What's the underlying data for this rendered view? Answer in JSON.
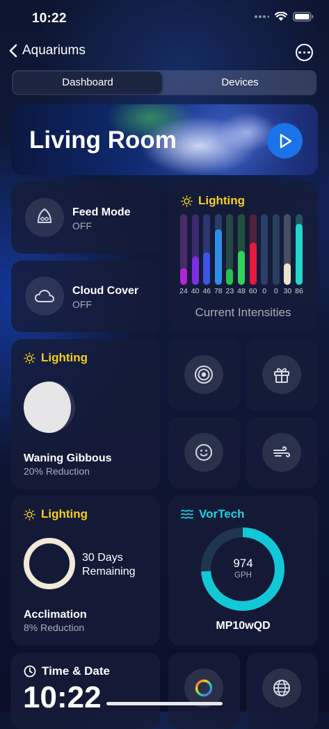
{
  "status": {
    "time": "10:22"
  },
  "nav": {
    "back_label": "Aquariums"
  },
  "segments": {
    "dashboard": "Dashboard",
    "devices": "Devices"
  },
  "hero": {
    "title": "Living Room"
  },
  "feed": {
    "title": "Feed Mode",
    "status": "OFF"
  },
  "cloud": {
    "title": "Cloud Cover",
    "status": "OFF"
  },
  "lighting_bars": {
    "title": "Lighting",
    "caption": "Current Intensities",
    "channels": [
      {
        "value": 24,
        "label": "24",
        "color": "#b026d6",
        "track": "#4a2a6a"
      },
      {
        "value": 40,
        "label": "40",
        "color": "#7b2fe0",
        "track": "#3a2c6e"
      },
      {
        "value": 46,
        "label": "46",
        "color": "#3f55e6",
        "track": "#2c3670"
      },
      {
        "value": 78,
        "label": "78",
        "color": "#2f8ee8",
        "track": "#263e6a"
      },
      {
        "value": 23,
        "label": "23",
        "color": "#26c24a",
        "track": "#234a44"
      },
      {
        "value": 48,
        "label": "48",
        "color": "#2fd45a",
        "track": "#22523e"
      },
      {
        "value": 60,
        "label": "60",
        "color": "#e8193c",
        "track": "#52223a"
      },
      {
        "value": 0,
        "label": "0",
        "color": "#3d6bb0",
        "track": "#2c3f66"
      },
      {
        "value": 0,
        "label": "0",
        "color": "#2e5a90",
        "track": "#28405e"
      },
      {
        "value": 30,
        "label": "30",
        "color": "#ebe6c8",
        "track": "#464d64"
      },
      {
        "value": 86,
        "label": "86",
        "color": "#27d4c8",
        "track": "#24525e"
      }
    ]
  },
  "moon": {
    "heading": "Lighting",
    "title": "Waning Gibbous",
    "subtitle": "20% Reduction"
  },
  "acclimation": {
    "heading": "Lighting",
    "days_line1": "30 Days",
    "days_line2": "Remaining",
    "title": "Acclimation",
    "subtitle": "8% Reduction"
  },
  "vortech": {
    "heading": "VorTech",
    "value": "974",
    "unit": "GPH",
    "model": "MP10wQD",
    "fill_fraction": 0.74
  },
  "timedate": {
    "heading": "Time & Date",
    "clock": "10:22"
  },
  "colors": {
    "accent_yellow": "#f5d019",
    "accent_cyan": "#1dd4e0",
    "play_blue": "#1a73e8"
  },
  "icons": {
    "target": "target-icon",
    "gift": "gift-icon",
    "smile": "smiley-icon",
    "wind": "wind-icon",
    "rainbow": "color-ring-icon",
    "globe": "globe-icon"
  }
}
